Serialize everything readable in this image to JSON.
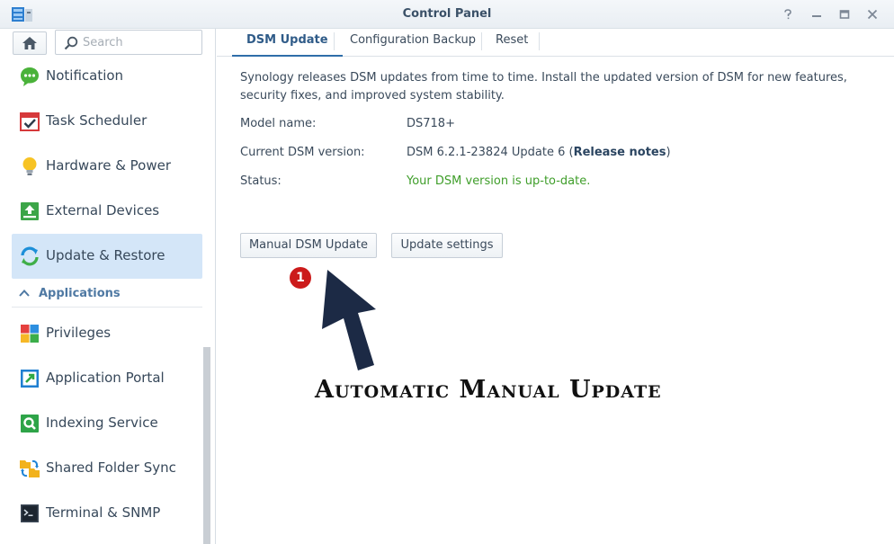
{
  "window": {
    "title": "Control Panel",
    "icons": [
      "control-panel-logo-icon",
      "help-icon",
      "minimize-icon",
      "maximize-icon",
      "close-icon"
    ]
  },
  "sidebar": {
    "search_placeholder": "Search",
    "items": [
      {
        "label": "Notification",
        "icon": "notification-icon"
      },
      {
        "label": "Task Scheduler",
        "icon": "task-scheduler-icon"
      },
      {
        "label": "Hardware & Power",
        "icon": "hardware-power-icon"
      },
      {
        "label": "External Devices",
        "icon": "external-devices-icon"
      },
      {
        "label": "Update & Restore",
        "icon": "update-restore-icon",
        "active": true
      }
    ],
    "section_label": "Applications",
    "app_items": [
      {
        "label": "Privileges",
        "icon": "privileges-icon"
      },
      {
        "label": "Application Portal",
        "icon": "application-portal-icon"
      },
      {
        "label": "Indexing Service",
        "icon": "indexing-service-icon"
      },
      {
        "label": "Shared Folder Sync",
        "icon": "shared-folder-sync-icon"
      },
      {
        "label": "Terminal & SNMP",
        "icon": "terminal-snmp-icon"
      }
    ]
  },
  "tabs": [
    {
      "label": "DSM Update",
      "active": true
    },
    {
      "label": "Configuration Backup"
    },
    {
      "label": "Reset"
    }
  ],
  "content": {
    "description": "Synology releases DSM updates from time to time. Install the updated version of DSM for new features, security fixes, and improved system stability.",
    "model_label": "Model name:",
    "model_value": "DS718+",
    "version_label": "Current DSM version:",
    "version_value": "DSM 6.2.1-23824 Update 6 (",
    "release_notes": "Release notes",
    "version_suffix": ")",
    "status_label": "Status:",
    "status_value": "Your DSM version is up-to-date."
  },
  "buttons": {
    "manual_update": "Manual DSM Update",
    "update_settings": "Update settings"
  },
  "annotation": {
    "badge": "1",
    "text": "Automatic Manual Update"
  },
  "colors": {
    "accent": "#2f6ea9",
    "active_row": "#d4e6f8",
    "status_ok": "#3f9e2a",
    "badge_red": "#cc1b1b",
    "arrow": "#1c2a45"
  }
}
